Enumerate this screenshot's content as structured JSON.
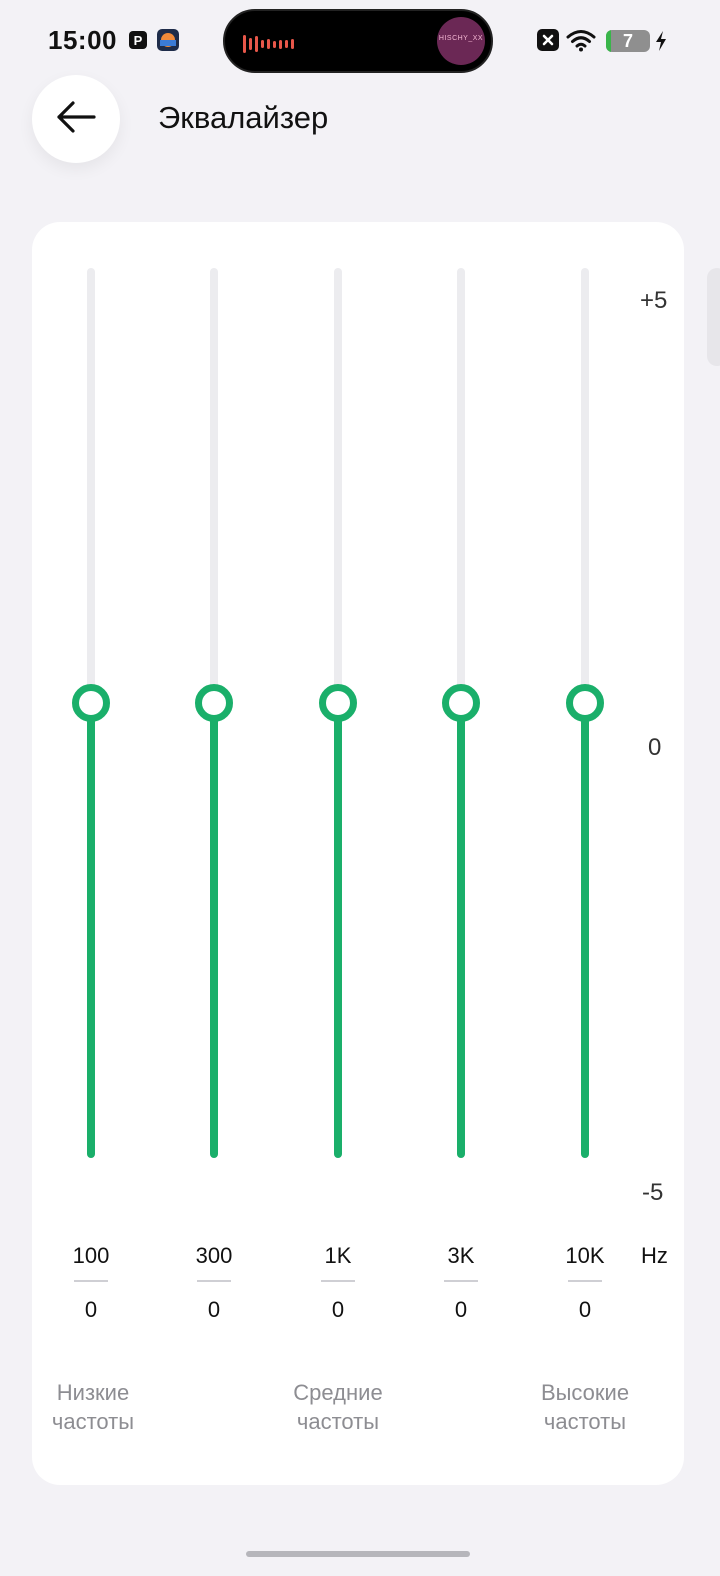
{
  "status_bar": {
    "time": "15:00",
    "battery_level": "7",
    "island_art_text": "HISCHY_XX",
    "icons": [
      "parking-icon",
      "app-thumbnail-icon",
      "audio-wave-icon",
      "close-box-icon",
      "wifi-icon",
      "battery-icon",
      "charging-bolt-icon"
    ]
  },
  "header": {
    "back_icon": "arrow-left-icon",
    "title": "Эквалайзер"
  },
  "equalizer": {
    "scale": {
      "max": "+5",
      "mid": "0",
      "min": "-5"
    },
    "unit": "Hz",
    "bands": [
      {
        "freq": "100",
        "gain": "0"
      },
      {
        "freq": "300",
        "gain": "0"
      },
      {
        "freq": "1K",
        "gain": "0"
      },
      {
        "freq": "3K",
        "gain": "0"
      },
      {
        "freq": "10K",
        "gain": "0"
      }
    ],
    "groups": {
      "low": "Низкие частоты",
      "mid": "Средние частоты",
      "high": "Высокие частоты"
    }
  },
  "colors": {
    "accent": "#1aaf6a",
    "track": "#ececef",
    "background": "#f3f2f6",
    "card": "#ffffff",
    "muted_text": "#8d8d92"
  }
}
